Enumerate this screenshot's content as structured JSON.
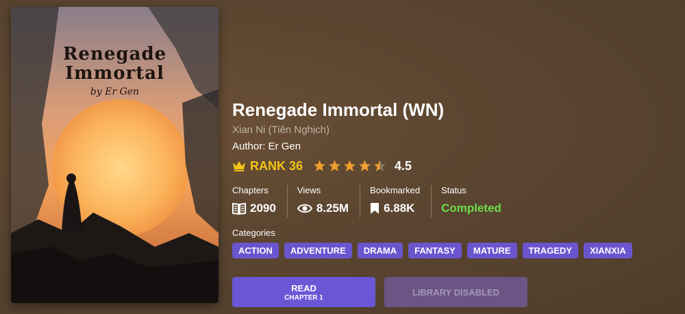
{
  "cover": {
    "title_line1": "Renegade",
    "title_line2": "Immortal",
    "author": "by Er Gen"
  },
  "novel": {
    "title": "Renegade Immortal (WN)",
    "alt_title": "Xian Ni (Tiên Nghịch)",
    "author": "Author: Er Gen",
    "rank": "RANK 36",
    "rating": "4.5",
    "rating_value": 4.5,
    "rating_max": 5
  },
  "stats": {
    "chapters_label": "Chapters",
    "chapters_value": "2090",
    "views_label": "Views",
    "views_value": "8.25M",
    "bookmarked_label": "Bookmarked",
    "bookmarked_value": "6.88K",
    "status_label": "Status",
    "status_value": "Completed"
  },
  "categories": {
    "label": "Categories",
    "items": [
      "ACTION",
      "ADVENTURE",
      "DRAMA",
      "FANTASY",
      "MATURE",
      "TRAGEDY",
      "XIANXIA"
    ]
  },
  "buttons": {
    "read_label": "READ",
    "read_sub": "CHAPTER 1",
    "library_label": "LIBRARY DISABLED"
  },
  "colors": {
    "accent": "#6b55cf",
    "rank": "#f5c518",
    "status": "#6fdc4c",
    "star": "#f0a030"
  },
  "icons": [
    "crown-icon",
    "star-icon",
    "book-icon",
    "eye-icon",
    "bookmark-icon"
  ]
}
